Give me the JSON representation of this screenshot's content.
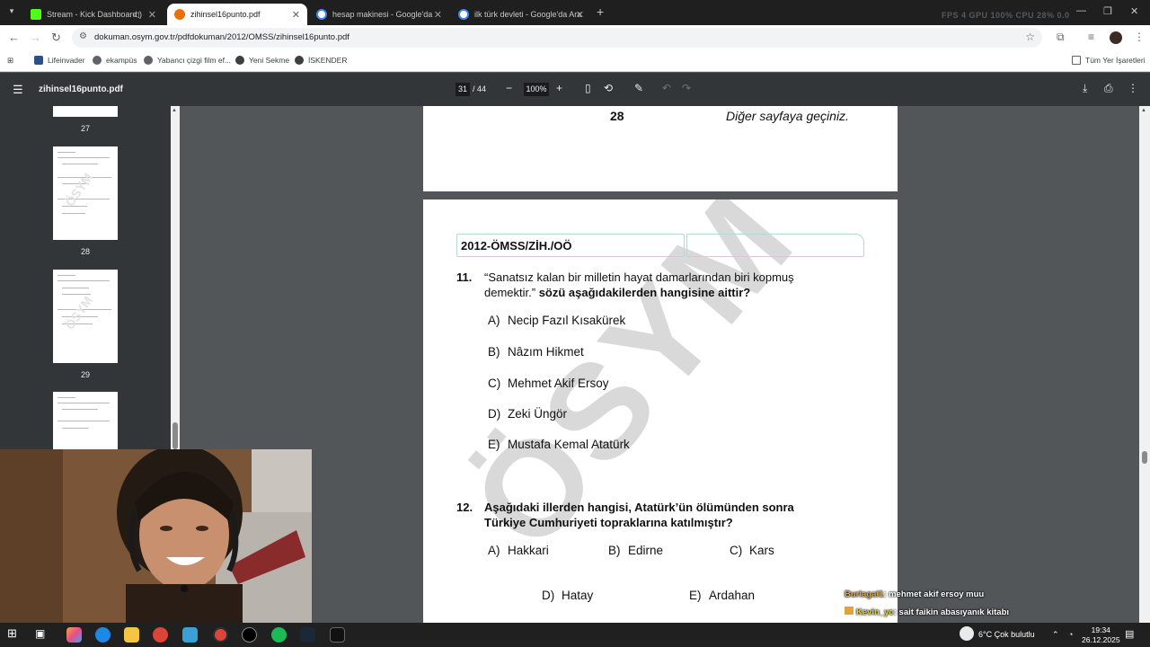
{
  "browser": {
    "tabs": [
      {
        "label": "Stream - Kick Dashboard",
        "active": false
      },
      {
        "label": "zihinsel16punto.pdf",
        "active": true
      },
      {
        "label": "hesap makinesi - Google'da Ara",
        "active": false
      },
      {
        "label": "ilk türk devleti - Google'da Ara",
        "active": false
      }
    ],
    "url": "dokuman.osym.gov.tr/pdfdokuman/2012/OMSS/zihinsel16punto.pdf",
    "overlay_stats": "FPS 4   GPU 100%   CPU 28%   0.0",
    "bookmarks": [
      "Lifeinvader",
      "ekampüs",
      "Yabancı çizgi film ef...",
      "Yeni Sekme",
      "İSKENDER"
    ],
    "all_bookmarks": "Tüm Yer İşaretleri"
  },
  "pdf_toolbar": {
    "file_name": "zihinsel16punto.pdf",
    "current_page": "31",
    "total_pages": "/ 44",
    "zoom": "100%"
  },
  "sidebar": {
    "thumbnails": [
      {
        "label": "27"
      },
      {
        "label": "28"
      },
      {
        "label": "29"
      }
    ]
  },
  "document": {
    "prev_page_number": "28",
    "prev_page_footer": "Diğer sayfaya geçiniz.",
    "header_code": "2012-ÖMSS/ZİH./OÖ",
    "watermark": "ÖSYM",
    "questions": [
      {
        "number": "11.",
        "text_line1": "“Sanatsız kalan bir milletin hayat damarlarından biri kopmuş",
        "text_line2_plain": "demektir.”",
        "text_line2_bold": "sözü aşağıdakilerden hangisine aittir?",
        "options": [
          {
            "letter": "A)",
            "text": "Necip Fazıl Kısakürek"
          },
          {
            "letter": "B)",
            "text": "Nâzım Hikmet"
          },
          {
            "letter": "C)",
            "text": "Mehmet Akif Ersoy"
          },
          {
            "letter": "D)",
            "text": "Zeki Üngör"
          },
          {
            "letter": "E)",
            "text": "Mustafa Kemal Atatürk"
          }
        ]
      },
      {
        "number": "12.",
        "text_line1": "Aşağıdaki illerden hangisi, Atatürk’ün ölümünden sonra",
        "text_line2": "Türkiye Cumhuriyeti topraklarına katılmıştır?",
        "options": [
          {
            "letter": "A)",
            "text": "Hakkari"
          },
          {
            "letter": "B)",
            "text": "Edirne"
          },
          {
            "letter": "C)",
            "text": "Kars"
          },
          {
            "letter": "D)",
            "text": "Hatay"
          },
          {
            "letter": "E)",
            "text": "Ardahan"
          }
        ]
      }
    ]
  },
  "chat": [
    {
      "user": "Burlagal1",
      "message": ": mehmet akif ersoy muu"
    },
    {
      "user": "Kevin_yc",
      "message": ": sait faikin abasıyanık kitabı"
    }
  ],
  "taskbar": {
    "weather": "6°C  Çok bulutlu",
    "time": "19:34",
    "date": "26.12.2025"
  }
}
